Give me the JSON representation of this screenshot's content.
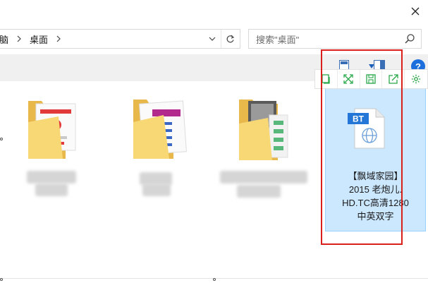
{
  "breadcrumb": {
    "items": [
      "电脑",
      "桌面"
    ]
  },
  "search": {
    "placeholder": "搜索\"桌面\""
  },
  "toolbar": {
    "help_label": "?"
  },
  "selected_file": {
    "badge": "BT",
    "name_lines": [
      "【飘域家园】",
      "2015 老炮儿.",
      "HD.TC高清1280",
      "中英双字"
    ]
  },
  "icons": {
    "close": "close-icon",
    "breadcrumb_separator": "chevron-right-icon",
    "address_dropdown": "chevron-down-icon",
    "refresh": "refresh-icon",
    "search": "search-icon",
    "view": "view-icon",
    "preview_pane": "preview-pane-icon",
    "help": "help-icon",
    "hover_toolbar": [
      "copy-icon",
      "fullscreen-icon",
      "save-icon",
      "share-icon",
      "settings-icon"
    ]
  },
  "colors": {
    "selection_fill": "#cce8ff",
    "selection_border": "#99d1ff",
    "highlight_rect": "#d9201a",
    "folder": "#f8d775",
    "hover_toolbar_icons": "#29a84a",
    "help": "#1c6fdc"
  }
}
